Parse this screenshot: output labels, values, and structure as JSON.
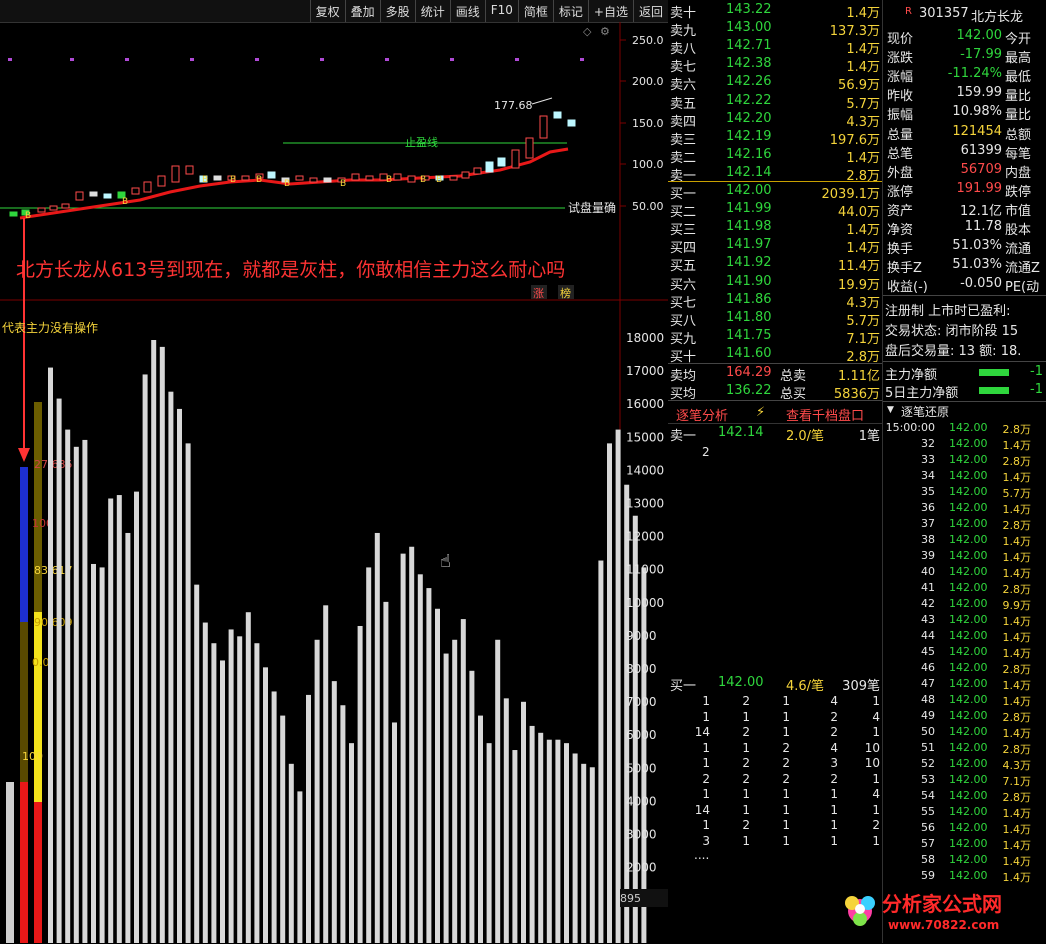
{
  "toolbar": {
    "buttons": [
      "复权",
      "叠加",
      "多股",
      "统计",
      "画线",
      "F10",
      "简框",
      "标记",
      "+自选",
      "返回"
    ]
  },
  "kline": {
    "price_axis": [
      "250.0",
      "200.0",
      "150.0",
      "100.0",
      "50.00"
    ],
    "high_marker": "177.68",
    "stop_label": "止盈线",
    "trial_label": "试盘量确",
    "annotation": "北方长龙从613号到现在，就都是灰柱，你敢相信主力这么耐心吗",
    "badge_zhang": "涨",
    "badge_bang": "榜",
    "buy_mark": "B"
  },
  "volume": {
    "indicator_label": "代表主力没有操作",
    "axis": [
      "18000",
      "17000",
      "16000",
      "15000",
      "14000",
      "13000",
      "12000",
      "11000",
      "10000",
      "9000",
      "8000",
      "7000",
      "6000",
      "5000",
      "4000",
      "3000",
      "2000"
    ],
    "corner_value": "895",
    "left_labels": [
      "27.685",
      "100",
      "83.617",
      "90.609",
      "0.0",
      "100"
    ]
  },
  "chart_data": {
    "type": "bar",
    "title": "",
    "ylim": [
      1000,
      18500
    ],
    "values": [
      17700,
      16800,
      15900,
      15400,
      15600,
      12000,
      11900,
      13900,
      14000,
      12900,
      14100,
      17500,
      18500,
      18300,
      17000,
      16500,
      15500,
      11400,
      10300,
      9700,
      9200,
      10100,
      9900,
      10600,
      9700,
      9000,
      8300,
      7600,
      6200,
      5400,
      8200,
      9800,
      10800,
      8600,
      7900,
      6800,
      10200,
      11900,
      12900,
      10900,
      7400,
      12300,
      12500,
      11700,
      11300,
      10700,
      9400,
      9800,
      10400,
      8900,
      7600,
      6800,
      9800,
      8100,
      6600,
      8000,
      7300,
      7100,
      6900,
      6900,
      6800,
      6500,
      6200,
      6100,
      12100,
      15500,
      15900,
      14300,
      13400,
      11900
    ]
  },
  "quote": {
    "asks": [
      {
        "label": "卖十",
        "price": "143.22",
        "vol": "1.4万"
      },
      {
        "label": "卖九",
        "price": "143.00",
        "vol": "137.3万"
      },
      {
        "label": "卖八",
        "price": "142.71",
        "vol": "1.4万"
      },
      {
        "label": "卖七",
        "price": "142.38",
        "vol": "1.4万"
      },
      {
        "label": "卖六",
        "price": "142.26",
        "vol": "56.9万"
      },
      {
        "label": "卖五",
        "price": "142.22",
        "vol": "5.7万"
      },
      {
        "label": "卖四",
        "price": "142.20",
        "vol": "4.3万"
      },
      {
        "label": "卖三",
        "price": "142.19",
        "vol": "197.6万"
      },
      {
        "label": "卖二",
        "price": "142.16",
        "vol": "1.4万"
      },
      {
        "label": "卖一",
        "price": "142.14",
        "vol": "2.8万"
      }
    ],
    "bids": [
      {
        "label": "买一",
        "price": "142.00",
        "vol": "2039.1万"
      },
      {
        "label": "买二",
        "price": "141.99",
        "vol": "44.0万"
      },
      {
        "label": "买三",
        "price": "141.98",
        "vol": "1.4万"
      },
      {
        "label": "买四",
        "price": "141.97",
        "vol": "1.4万"
      },
      {
        "label": "买五",
        "price": "141.92",
        "vol": "11.4万"
      },
      {
        "label": "买六",
        "price": "141.90",
        "vol": "19.9万"
      },
      {
        "label": "买七",
        "price": "141.86",
        "vol": "4.3万"
      },
      {
        "label": "买八",
        "price": "141.80",
        "vol": "5.7万"
      },
      {
        "label": "买九",
        "price": "141.75",
        "vol": "7.1万"
      },
      {
        "label": "买十",
        "price": "141.60",
        "vol": "2.8万"
      }
    ],
    "sell_avg_label": "卖均",
    "sell_avg": "164.29",
    "sell_total_label": "总卖",
    "sell_total": "1.11亿",
    "buy_avg_label": "买均",
    "buy_avg": "136.22",
    "buy_total_label": "总买",
    "buy_total": "5836万"
  },
  "tick_analysis": {
    "tab1": "逐笔分析",
    "tab2": "查看千档盘口",
    "ask1_label": "卖一",
    "ask1_price": "142.14",
    "ask1_avg": "2.0/笔",
    "ask1_count": "1笔",
    "ask1_list": [
      "2"
    ],
    "bid1_label": "买一",
    "bid1_price": "142.00",
    "bid1_avg": "4.6/笔",
    "bid1_count": "309笔",
    "bid1_rows": [
      [
        "1",
        "2",
        "1",
        "4",
        "1"
      ],
      [
        "1",
        "1",
        "1",
        "2",
        "4"
      ],
      [
        "14",
        "2",
        "1",
        "2",
        "1"
      ],
      [
        "1",
        "1",
        "2",
        "4",
        "10"
      ],
      [
        "1",
        "2",
        "2",
        "3",
        "10"
      ],
      [
        "2",
        "2",
        "2",
        "2",
        "1"
      ],
      [
        "1",
        "1",
        "1",
        "1",
        "4"
      ],
      [
        "14",
        "1",
        "1",
        "1",
        "1"
      ],
      [
        "1",
        "2",
        "1",
        "1",
        "2"
      ],
      [
        "3",
        "1",
        "1",
        "1",
        "1"
      ]
    ],
    "more": "...."
  },
  "info": {
    "r_tag": "R",
    "code": "301357",
    "name": "北方长龙",
    "rows": [
      {
        "k": "现价",
        "v": "142.00",
        "k2": "今开",
        "c": "green"
      },
      {
        "k": "涨跌",
        "v": "-17.99",
        "k2": "最高",
        "c": "green"
      },
      {
        "k": "涨幅",
        "v": "-11.24%",
        "k2": "最低",
        "c": "green"
      },
      {
        "k": "昨收",
        "v": "159.99",
        "k2": "量比",
        "c": "white"
      },
      {
        "k": "振幅",
        "v": "10.98%",
        "k2": "量比",
        "c": "white"
      },
      {
        "k": "总量",
        "v": "121454",
        "k2": "总额",
        "c": "yellow"
      },
      {
        "k": "总笔",
        "v": "61399",
        "k2": "每笔",
        "c": "white"
      },
      {
        "k": "外盘",
        "v": "56709",
        "k2": "内盘",
        "c": "red"
      },
      {
        "k": "涨停",
        "v": "191.99",
        "k2": "跌停",
        "c": "red"
      },
      {
        "k": "资产",
        "v": "12.1亿",
        "k2": "市值",
        "c": "white"
      },
      {
        "k": "净资",
        "v": "11.78",
        "k2": "股本",
        "c": "white"
      },
      {
        "k": "换手",
        "v": "51.03%",
        "k2": "流通",
        "c": "white"
      },
      {
        "k": "换手Z",
        "v": "51.03%",
        "k2": "流通Z",
        "c": "white"
      },
      {
        "k": "收益(-)",
        "v": "-0.050",
        "k2": "PE(动",
        "c": "white"
      }
    ],
    "reg_line": "注册制 上市时已盈利:",
    "status_line": "交易状态: 闭市阶段 15",
    "after_line": "盘后交易量: 13  额: 18.",
    "main_flow": "主力净额",
    "main_flow5": "5日主力净额",
    "main_flow_val": "-1",
    "main_flow5_val": "-1",
    "restore_title": "逐笔还原"
  },
  "ticks": [
    {
      "t": "15:00:00",
      "p": "142.00",
      "v": "2.8万"
    },
    {
      "t": "32",
      "p": "142.00",
      "v": "1.4万"
    },
    {
      "t": "33",
      "p": "142.00",
      "v": "2.8万"
    },
    {
      "t": "34",
      "p": "142.00",
      "v": "1.4万"
    },
    {
      "t": "35",
      "p": "142.00",
      "v": "5.7万"
    },
    {
      "t": "36",
      "p": "142.00",
      "v": "1.4万"
    },
    {
      "t": "37",
      "p": "142.00",
      "v": "2.8万"
    },
    {
      "t": "38",
      "p": "142.00",
      "v": "1.4万"
    },
    {
      "t": "39",
      "p": "142.00",
      "v": "1.4万"
    },
    {
      "t": "40",
      "p": "142.00",
      "v": "1.4万"
    },
    {
      "t": "41",
      "p": "142.00",
      "v": "2.8万"
    },
    {
      "t": "42",
      "p": "142.00",
      "v": "9.9万"
    },
    {
      "t": "43",
      "p": "142.00",
      "v": "1.4万"
    },
    {
      "t": "44",
      "p": "142.00",
      "v": "1.4万"
    },
    {
      "t": "45",
      "p": "142.00",
      "v": "1.4万"
    },
    {
      "t": "46",
      "p": "142.00",
      "v": "2.8万"
    },
    {
      "t": "47",
      "p": "142.00",
      "v": "1.4万"
    },
    {
      "t": "48",
      "p": "142.00",
      "v": "1.4万"
    },
    {
      "t": "49",
      "p": "142.00",
      "v": "2.8万"
    },
    {
      "t": "50",
      "p": "142.00",
      "v": "1.4万"
    },
    {
      "t": "51",
      "p": "142.00",
      "v": "2.8万"
    },
    {
      "t": "52",
      "p": "142.00",
      "v": "4.3万"
    },
    {
      "t": "53",
      "p": "142.00",
      "v": "7.1万"
    },
    {
      "t": "54",
      "p": "142.00",
      "v": "2.8万"
    },
    {
      "t": "55",
      "p": "142.00",
      "v": "1.4万"
    },
    {
      "t": "56",
      "p": "142.00",
      "v": "1.4万"
    },
    {
      "t": "57",
      "p": "142.00",
      "v": "1.4万"
    },
    {
      "t": "58",
      "p": "142.00",
      "v": "1.4万"
    },
    {
      "t": "59",
      "p": "142.00",
      "v": "1.4万"
    }
  ],
  "watermark": {
    "title": "分析家公式网",
    "url": "www.70822.com"
  }
}
